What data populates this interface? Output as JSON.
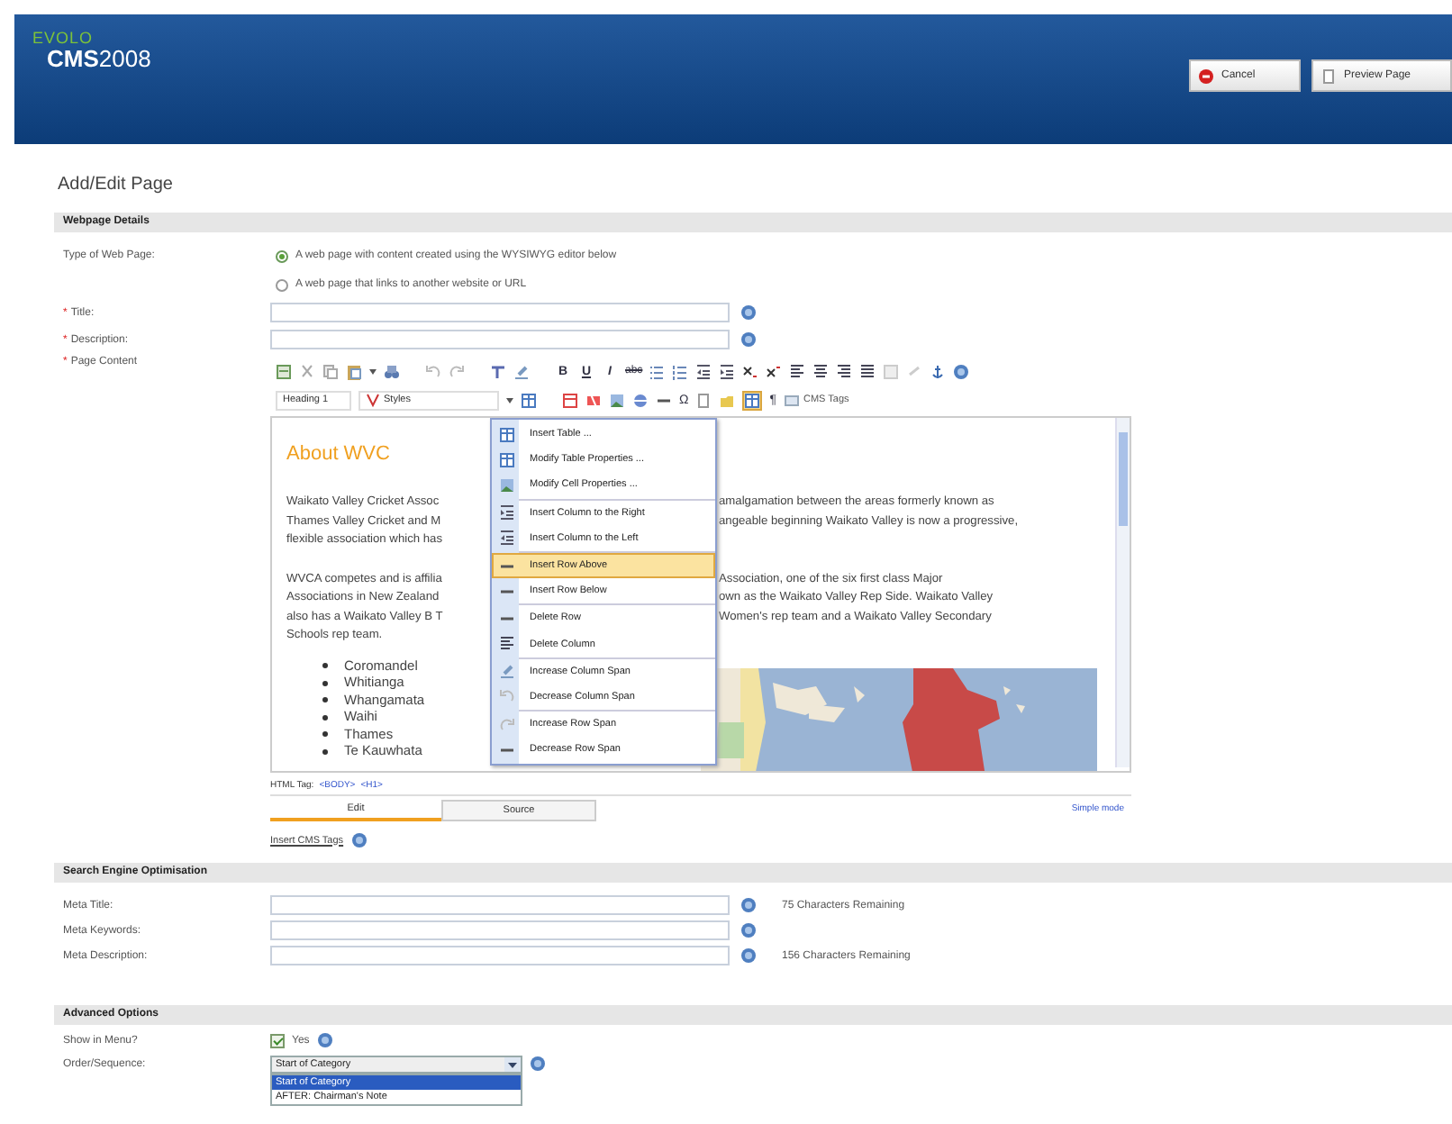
{
  "header": {
    "logo_top": "EVOLO",
    "logo_main": "**CMS**2008",
    "buttons": [
      {
        "kind": "cancel",
        "label": "Cancel"
      },
      {
        "kind": "preview",
        "label": "Preview Page"
      }
    ]
  },
  "page_title": "Add/Edit Page",
  "webpage_details": {
    "title": "Webpage Details",
    "type_label": "Type of Web Page:",
    "type_options": [
      {
        "label": "A web page with content created using the WYSIWYG editor below",
        "selected": true
      },
      {
        "label": "A web page that links to another website or URL",
        "selected": false
      }
    ],
    "fields": [
      {
        "label": "Title:",
        "required_mark": "*"
      },
      {
        "label": "Description:",
        "required_mark": "*"
      }
    ],
    "content_label": "Page Content",
    "content_required_mark": "*"
  },
  "editor": {
    "format_buttons": [
      {
        "label": "B",
        "kind": "bold"
      },
      {
        "label": "U",
        "kind": "underline"
      },
      {
        "label": "I",
        "kind": "italic"
      },
      {
        "label": "abc",
        "kind": "strike"
      }
    ],
    "block_select": "Heading 1",
    "style_select": "Styles",
    "symbol_button": "Ω",
    "pilcrow_button": "¶",
    "cms_tags_button": "CMS Tags",
    "heading": "About WVC",
    "paragraphs": [
      [
        {
          "left": "Waikato Valley Cricket Assoc",
          "right": "amalgamation between the areas formerly known as"
        },
        {
          "left": "Thames Valley Cricket and M",
          "right": "angeable beginning Waikato Valley is now a progressive,"
        },
        {
          "left": "flexible association which has"
        }
      ],
      [
        {
          "left": "WVCA competes and is affilia",
          "right": "Association, one of the six first class Major"
        },
        {
          "left": "Associations in New Zealand",
          "right": "own as the Waikato Valley Rep Side. Waikato Valley"
        },
        {
          "left": "also has a Waikato Valley B T",
          "right": "Women's rep team and a Waikato Valley Secondary"
        },
        {
          "left": "Schools rep team."
        }
      ]
    ],
    "bullets": [
      "Coromandel",
      "Whitianga",
      "Whangamata",
      "Waihi",
      "Thames",
      "Te Kauwhata"
    ],
    "menu": {
      "groups": [
        [
          {
            "label": "Insert Table ...",
            "selected": false
          },
          {
            "label": "Modify Table Properties ...",
            "selected": false
          },
          {
            "label": "Modify Cell Properties ...",
            "selected": false
          }
        ],
        [
          {
            "label": "Insert Column to the Right",
            "selected": false
          },
          {
            "label": "Insert Column to the Left",
            "selected": false
          }
        ],
        [
          {
            "label": "Insert Row Above",
            "selected": true
          },
          {
            "label": "Insert Row Below",
            "selected": false
          }
        ],
        [
          {
            "label": "Delete Row",
            "selected": false
          },
          {
            "label": "Delete Column",
            "selected": false
          }
        ],
        [
          {
            "label": "Increase Column Span",
            "selected": false
          },
          {
            "label": "Decrease Column Span",
            "selected": false
          }
        ],
        [
          {
            "label": "Increase Row Span",
            "selected": false
          },
          {
            "label": "Decrease Row Span",
            "selected": false
          }
        ]
      ]
    },
    "html_tag_label": "HTML Tag:",
    "html_tags": [
      "<BODY>",
      "<H1>"
    ],
    "tabs": [
      {
        "label": "Edit",
        "selected": true
      },
      {
        "label": "Source",
        "selected": false
      }
    ],
    "simple_mode": "Simple mode",
    "insert_cms_tags": "Insert CMS Tags"
  },
  "seo": {
    "title": "Search Engine Optimisation",
    "fields": [
      {
        "label": "Meta Title:",
        "remaining": "75 Characters Remaining"
      },
      {
        "label": "Meta Keywords:"
      },
      {
        "label": "Meta Description:",
        "remaining": "156 Characters Remaining"
      }
    ]
  },
  "advanced": {
    "title": "Advanced Options",
    "show_in_menu": {
      "label": "Show in Menu?",
      "checked": true,
      "option": "Yes"
    },
    "order": {
      "label": "Order/Sequence:",
      "value": "Start of Category",
      "options": [
        {
          "label": "Start of Category",
          "selected": true
        },
        {
          "label": "AFTER: Chairman's Note",
          "selected": false
        }
      ]
    }
  }
}
